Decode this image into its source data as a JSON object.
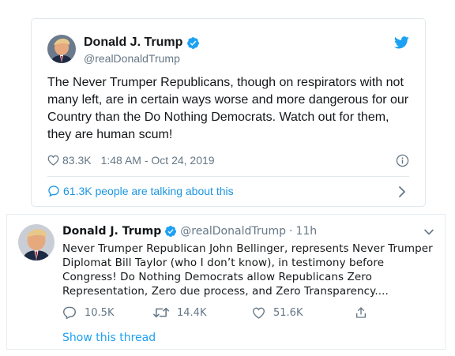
{
  "embed": {
    "display_name": "Donald J. Trump",
    "handle": "@realDonaldTrump",
    "text": "The Never Trumper Republicans, though on respirators with not many left, are in certain ways worse and more dangerous for our Country than the Do Nothing Democrats. Watch out for them, they are human scum!",
    "likes": "83.3K",
    "timestamp": "1:48 AM - Oct 24, 2019",
    "talking": "61.3K people are talking about this",
    "icons": [
      "verified-badge-icon",
      "twitter-bird-icon",
      "heart-icon",
      "info-icon",
      "comment-icon",
      "chevron-right-icon"
    ]
  },
  "timeline_tweet": {
    "display_name": "Donald J. Trump",
    "handle": "@realDonaldTrump",
    "separator": "·",
    "age": "11h",
    "text": "Never Trumper Republican John Bellinger, represents Never Trumper Diplomat Bill Taylor (who I don’t know), in testimony before Congress! Do Nothing Democrats allow Republicans Zero Representation, Zero due process, and Zero Transparency....",
    "replies": "10.5K",
    "retweets": "14.4K",
    "likes": "51.6K",
    "show_thread": "Show this thread",
    "icons": [
      "verified-badge-icon",
      "chevron-down-icon",
      "reply-icon",
      "retweet-icon",
      "heart-icon",
      "share-icon"
    ]
  },
  "colors": {
    "accent": "#1da1f2",
    "link": "#1b95e0",
    "muted": "#657786",
    "border": "#e1e8ed"
  }
}
